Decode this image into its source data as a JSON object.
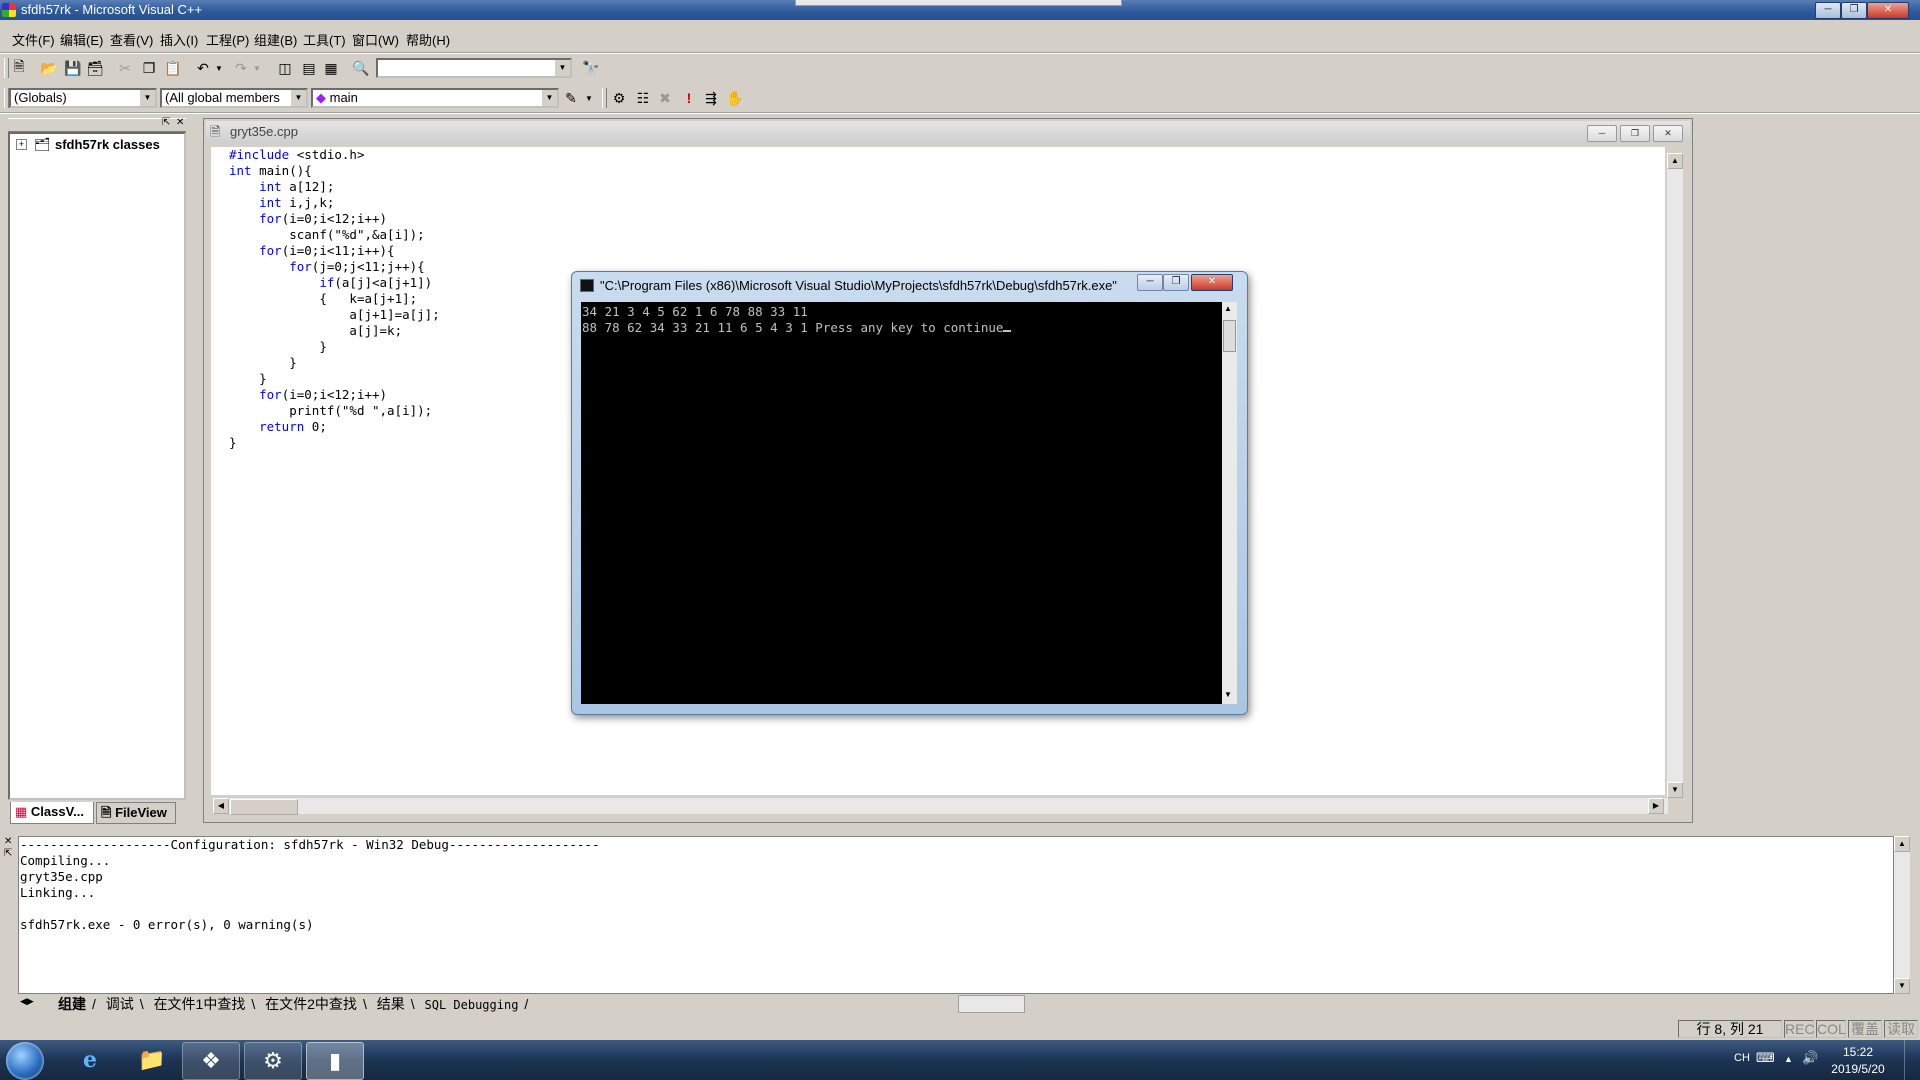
{
  "window": {
    "title": "sfdh57rk - Microsoft Visual C++"
  },
  "menu": [
    "文件(F)",
    "编辑(E)",
    "查看(V)",
    "插入(I)",
    "工程(P)",
    "组建(B)",
    "工具(T)",
    "窗口(W)",
    "帮助(H)"
  ],
  "wizard_bar": {
    "scope": "(Globals)",
    "filter": "(All global members",
    "member": "main"
  },
  "workspace": {
    "root": "sfdh57rk classes",
    "tabs": [
      "ClassV...",
      "FileView"
    ]
  },
  "editor": {
    "file_title": "gryt35e.cpp",
    "code": [
      {
        "kw": "#include",
        "rest": " <stdio.h>"
      },
      {
        "kw": "int",
        "rest": " main(){"
      },
      {
        "indent": "    ",
        "kw": "int",
        "rest": " a[12];"
      },
      {
        "indent": "    ",
        "kw": "int",
        "rest": " i,j,k;"
      },
      {
        "indent": "    ",
        "kw": "for",
        "rest": "(i=0;i<12;i++)"
      },
      {
        "indent": "        ",
        "rest": "scanf(\"%d\",&a[i]);"
      },
      {
        "indent": "    ",
        "kw": "for",
        "rest": "(i=0;i<11;i++){"
      },
      {
        "indent": "        ",
        "kw": "for",
        "rest": "(j=0;j<11;j++){"
      },
      {
        "indent": "            ",
        "kw": "if",
        "rest": "(a[j]<a[j+1])"
      },
      {
        "indent": "            ",
        "rest": "{   k=a[j+1];"
      },
      {
        "indent": "                ",
        "rest": "a[j+1]=a[j];"
      },
      {
        "indent": "                ",
        "rest": "a[j]=k;"
      },
      {
        "indent": "            ",
        "rest": "}"
      },
      {
        "indent": "        ",
        "rest": "}"
      },
      {
        "indent": "    ",
        "rest": "}"
      },
      {
        "indent": "    ",
        "kw": "for",
        "rest": "(i=0;i<12;i++)"
      },
      {
        "indent": "        ",
        "rest": "printf(\"%d \",a[i]);"
      },
      {
        "indent": "    ",
        "kw": "return",
        "rest": " 0;"
      },
      {
        "rest": "}"
      }
    ]
  },
  "console": {
    "title": "\"C:\\Program Files (x86)\\Microsoft Visual Studio\\MyProjects\\sfdh57rk\\Debug\\sfdh57rk.exe\"",
    "lines": [
      "34 21 3 4 5 62 1 6 78 88 33 11",
      "88 78 62 34 33 21 11 6 5 4 3 1 Press any key to continue"
    ]
  },
  "output": {
    "lines": [
      "--------------------Configuration: sfdh57rk - Win32 Debug--------------------",
      "Compiling...",
      "gryt35e.cpp",
      "Linking...",
      "",
      "sfdh57rk.exe - 0 error(s), 0 warning(s)"
    ],
    "tabs": [
      "组建",
      "调试",
      "在文件1中查找",
      "在文件2中查找",
      "结果",
      "SQL Debugging"
    ]
  },
  "status": {
    "position": "行 8, 列 21",
    "indicators": [
      "REC",
      "COL",
      "覆盖",
      "读取"
    ]
  },
  "taskbar": {
    "tray_lang": "CH",
    "time": "15:22",
    "date": "2019/5/20"
  }
}
